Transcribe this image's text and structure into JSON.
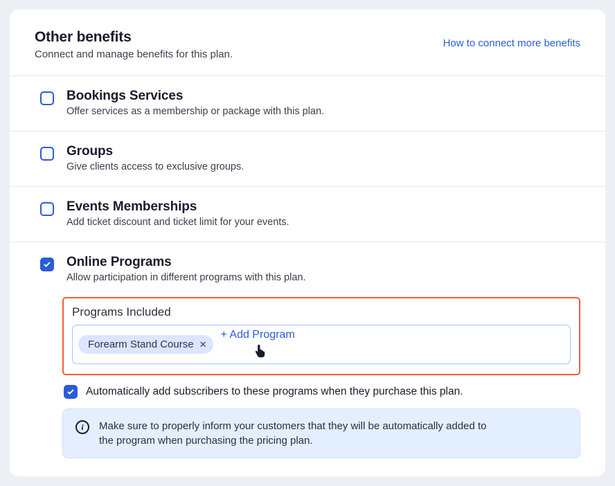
{
  "header": {
    "title": "Other benefits",
    "subtitle": "Connect and manage benefits for this plan.",
    "help_link": "How to connect more benefits"
  },
  "benefits": {
    "bookings": {
      "title": "Bookings Services",
      "desc": "Offer services as a membership or package with this plan.",
      "checked": false
    },
    "groups": {
      "title": "Groups",
      "desc": "Give clients access to exclusive groups.",
      "checked": false
    },
    "events": {
      "title": "Events Memberships",
      "desc": "Add ticket discount and ticket limit for your events.",
      "checked": false
    },
    "programs": {
      "title": "Online Programs",
      "desc": "Allow participation in different programs with this plan.",
      "checked": true,
      "section_label": "Programs Included",
      "chip": "Forearm Stand Course",
      "add_label": "+ Add Program",
      "auto_add_label": "Automatically add subscribers to these programs when they purchase this plan.",
      "auto_add_checked": true,
      "notice": "Make sure to properly inform your customers that they will be automatically added to the program when purchasing the pricing plan."
    }
  }
}
